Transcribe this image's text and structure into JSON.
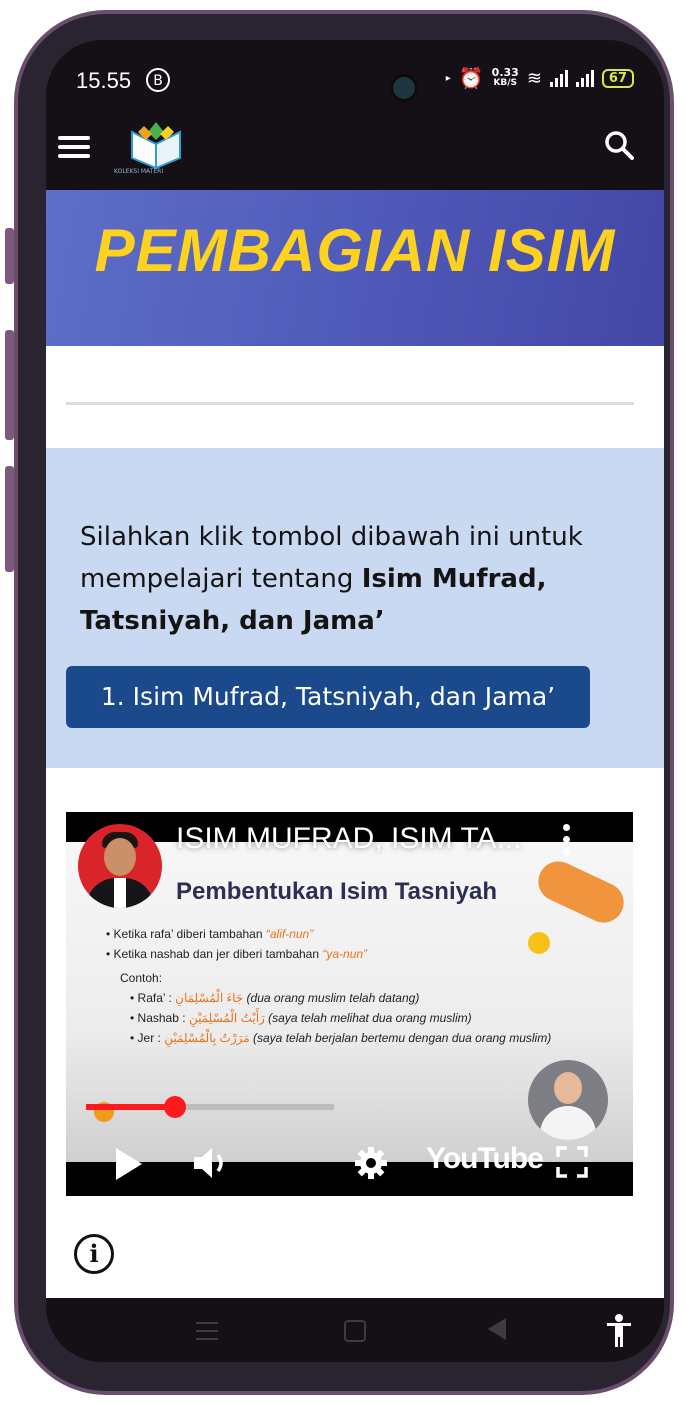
{
  "status_bar": {
    "time": "15.55",
    "notification_badge": "B",
    "net_speed_value": "0.33",
    "net_speed_unit": "KB/S",
    "battery": "67"
  },
  "app_bar": {
    "logo_text": "KOLEKSI MATERI"
  },
  "banner": {
    "title": "PEMBAGIAN ISIM",
    "bg_color": "#4f58b7",
    "title_color": "#ffd21f"
  },
  "info_box": {
    "text_plain": "Silahkan klik tombol dibawah ini untuk mempelajari tentang ",
    "text_bold": "Isim Mufrad, Tatsniyah, dan Jama’",
    "button_label": "1. Isim Mufrad, Tatsniyah, dan Jama’",
    "bg_color": "#c9d9f1",
    "button_color": "#1b4a8c"
  },
  "video": {
    "title": "ISIM MUFRAD, ISIM TA...",
    "slide_title": "Pembentukan Isim Tasniyah",
    "bullets": [
      {
        "text": "Ketika rafa’ diberi tambahan ",
        "highlight": "“alif-nun”"
      },
      {
        "text": "Ketika nashab dan jer diberi tambahan ",
        "highlight": "“ya-nun”"
      }
    ],
    "example_label": "Contoh:",
    "examples": [
      {
        "case": "Rafa’",
        "arabic": "جَاءَ الْمُسْلِمَانِ",
        "meaning": "(dua orang muslim telah datang)"
      },
      {
        "case": "Nashab",
        "arabic": "رَأَيْتُ الْمُسْلِمَيْنِ",
        "meaning": "(saya telah melihat dua orang muslim)"
      },
      {
        "case": "Jer",
        "arabic": "مَرَرْتُ بِالْمُسْلِمَيْنِ",
        "meaning": "(saya telah berjalan bertemu dengan dua orang muslim)"
      }
    ],
    "progress": 0.36,
    "brand": "YouTube",
    "progress_color": "#ff1b1b"
  },
  "icons": {
    "menu": "hamburger-icon",
    "search": "search-icon",
    "info": "info-icon",
    "accessibility": "accessibility-icon"
  }
}
